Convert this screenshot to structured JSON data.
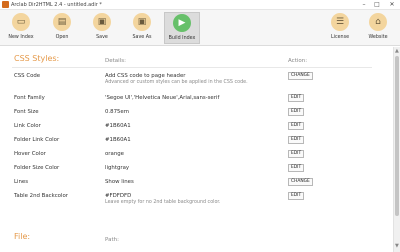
{
  "window": {
    "title": "Arclab Dir2HTML 2.4 - untitled.adir *",
    "minimize_glyph": "–",
    "maximize_glyph": "□",
    "close_glyph": "✕"
  },
  "toolbar": {
    "new_index": "New Index",
    "open": "Open",
    "save": "Save",
    "save_as": "Save As",
    "build_index": "Build Index",
    "license": "License",
    "website": "Website"
  },
  "css_section": {
    "title": "CSS Styles:",
    "details_header": "Details:",
    "action_header": "Action:",
    "rows": [
      {
        "label": "CSS Code",
        "value": "Add CSS code to page header",
        "hint": "Advanced or custom styles can be applied in the CSS code.",
        "button": "CHANGE"
      },
      {
        "label": "Font Family",
        "value": "'Segoe UI','Helvetica Neue',Arial,sans-serif",
        "hint": "",
        "button": "EDIT"
      },
      {
        "label": "Font Size",
        "value": "0.875em",
        "hint": "",
        "button": "EDIT"
      },
      {
        "label": "Link Color",
        "value": "#1B60A1",
        "hint": "",
        "button": "EDIT"
      },
      {
        "label": "Folder Link Color",
        "value": "#1B60A1",
        "hint": "",
        "button": "EDIT"
      },
      {
        "label": "Hover Color",
        "value": "orange",
        "hint": "",
        "button": "EDIT"
      },
      {
        "label": "Folder Size Color",
        "value": "lightgray",
        "hint": "",
        "button": "EDIT"
      },
      {
        "label": "Lines",
        "value": "Show lines",
        "hint": "",
        "button": "CHANGE"
      },
      {
        "label": "Table 2nd Backcolor",
        "value": "#FDFDFD",
        "hint": "Leave empty for no 2nd table background color.",
        "button": "EDIT"
      }
    ]
  },
  "file_section": {
    "title": "File:",
    "path_header": "Path:"
  }
}
